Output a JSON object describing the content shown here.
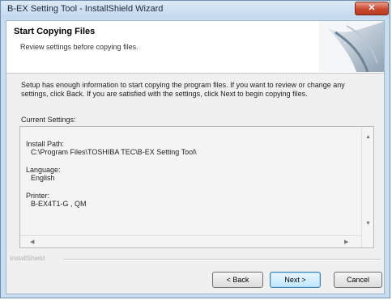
{
  "window": {
    "title": "B-EX Setting Tool - InstallShield Wizard",
    "close_glyph": "✕"
  },
  "header": {
    "title": "Start Copying Files",
    "subtitle": "Review settings before copying files."
  },
  "description": "Setup has enough information to start copying the program files. If you want to review or change any settings, click Back. If you are satisfied with the settings, click Next to begin copying files.",
  "settings": {
    "label": "Current Settings:",
    "install_path_label": "Install Path:",
    "install_path_value": "C:\\Program Files\\TOSHIBA TEC\\B-EX Setting Tool\\",
    "language_label": "Language:",
    "language_value": "English",
    "printer_label": "Printer:",
    "printer_value": "B-EX4T1-G , QM"
  },
  "footer": {
    "brand": "InstallShield"
  },
  "buttons": {
    "back": "< Back",
    "next": "Next >",
    "cancel": "Cancel"
  },
  "icons": {
    "close": "close-icon",
    "wizard": "wizard-graphic",
    "scroll_up": "scroll-up-arrow",
    "scroll_down": "scroll-down-arrow",
    "scroll_left": "scroll-left-arrow",
    "scroll_right": "scroll-right-arrow"
  },
  "colors": {
    "title_bar": "#c9ddf1",
    "close_button": "#c9492f",
    "default_button": "#bee6fd"
  }
}
